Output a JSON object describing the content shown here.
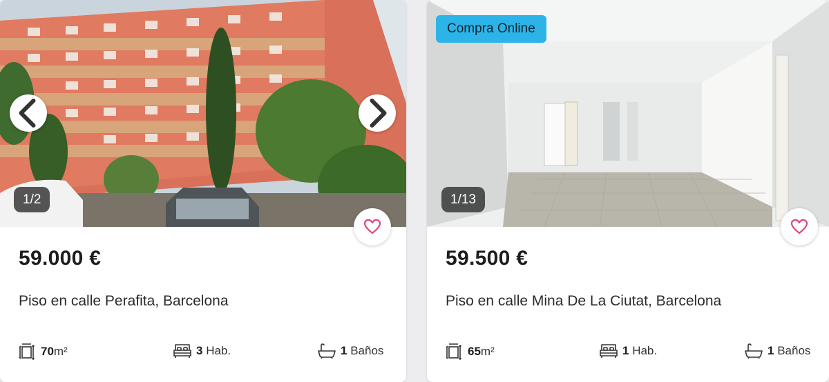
{
  "listings": [
    {
      "photo": {
        "description": "Brick apartment building exterior",
        "counter": "1/2"
      },
      "price": "59.000 €",
      "title": "Piso en calle Perafita, Barcelona",
      "features": {
        "area_value": "70",
        "area_unit": "m²",
        "rooms_value": "3",
        "rooms_unit": "Hab.",
        "baths_value": "1",
        "baths_unit": "Baños"
      }
    },
    {
      "photo": {
        "description": "Empty interior living room",
        "counter": "1/13"
      },
      "badge": "Compra Online",
      "price": "59.500 €",
      "title": "Piso en calle Mina De La Ciutat, Barcelona",
      "features": {
        "area_value": "65",
        "area_unit": "m²",
        "rooms_value": "1",
        "rooms_unit": "Hab.",
        "baths_value": "1",
        "baths_unit": "Baños"
      }
    }
  ],
  "colors": {
    "badge": "#2cb4e8",
    "heart": "#e0457b",
    "background": "#ededf0"
  },
  "icons": [
    "chevron-left-icon",
    "chevron-right-icon",
    "heart-icon",
    "area-icon",
    "bed-icon",
    "bathtub-icon"
  ]
}
